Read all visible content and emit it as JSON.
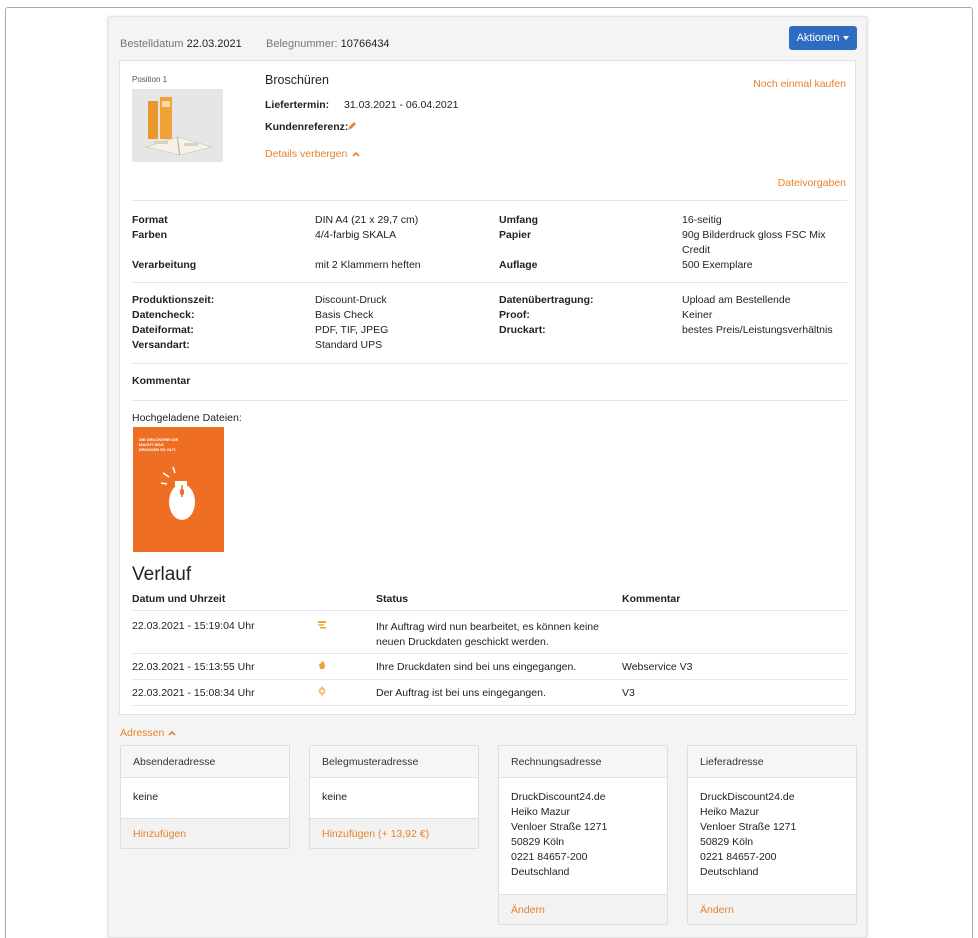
{
  "header": {
    "order_date_label": "Bestelldatum",
    "order_date": "22.03.2021",
    "receipt_label": "Belegnummer:",
    "receipt_number": "10766434",
    "actions_label": "Aktionen"
  },
  "position": {
    "label": "Position 1",
    "product": "Broschüren",
    "delivery_label": "Liefertermin:",
    "delivery_value": "31.03.2021 - 06.04.2021",
    "customer_ref_label": "Kundenreferenz:",
    "hide_details": "Details verbergen",
    "buy_again": "Noch einmal kaufen",
    "file_specs": "Dateivorgaben"
  },
  "specs1": [
    {
      "k1": "Format",
      "v1": "DIN A4 (21 x 29,7 cm)",
      "k2": "Umfang",
      "v2": "16-seitig"
    },
    {
      "k1": "Farben",
      "v1": "4/4-farbig SKALA",
      "k2": "Papier",
      "v2": "90g Bilderdruck gloss FSC Mix Credit"
    },
    {
      "k1": "Verarbeitung",
      "v1": "mit 2 Klammern heften",
      "k2": "Auflage",
      "v2": "500 Exemplare"
    }
  ],
  "specs2": [
    {
      "k1": "Produktionszeit:",
      "v1": "Discount-Druck",
      "k2": "Datenübertragung:",
      "v2": "Upload am Bestellende"
    },
    {
      "k1": "Datencheck:",
      "v1": "Basis Check",
      "k2": "Proof:",
      "v2": "Keiner"
    },
    {
      "k1": "Dateiformat:",
      "v1": "PDF, TIF, JPEG",
      "k2": "Druckart:",
      "v2": "bestes Preis/Leistungsverhältnis"
    },
    {
      "k1": "Versandart:",
      "v1": "Standard UPS",
      "k2": "",
      "v2": ""
    }
  ],
  "comment_label": "Kommentar",
  "uploaded_label": "Hochgeladene Dateien:",
  "upload_thumb_text": "DIE DRUCKEREI DIE MACHT WAS DRUCKEN SO GUT.",
  "history": {
    "title": "Verlauf",
    "col_date": "Datum und Uhrzeit",
    "col_status": "Status",
    "col_comment": "Kommentar",
    "rows": [
      {
        "date": "22.03.2021 - 15:19:04 Uhr",
        "icon": "process-icon",
        "status_line1": "Ihr Auftrag wird nun bearbeitet, es können keine",
        "status_line2": "neuen Druckdaten geschickt werden.",
        "comment": ""
      },
      {
        "date": "22.03.2021 - 15:13:55 Uhr",
        "icon": "hand-icon",
        "status_line1": "Ihre Druckdaten sind bei uns eingegangen.",
        "status_line2": "",
        "comment": "Webservice V3"
      },
      {
        "date": "22.03.2021 - 15:08:34 Uhr",
        "icon": "gear-icon",
        "status_line1": "Der Auftrag ist bei uns eingegangen.",
        "status_line2": "",
        "comment": "V3"
      }
    ]
  },
  "addresses": {
    "toggle": "Adressen",
    "cards": [
      {
        "title": "Absenderadresse",
        "lines": [
          "keine"
        ],
        "action": "Hinzufügen"
      },
      {
        "title": "Belegmusteradresse",
        "lines": [
          "keine"
        ],
        "action": "Hinzufügen (+ 13,92 €)"
      },
      {
        "title": "Rechnungsadresse",
        "lines": [
          "DruckDiscount24.de",
          "Heiko Mazur",
          "Venloer Straße 1271",
          "50829 Köln",
          "0221 84657-200",
          "Deutschland"
        ],
        "action": "Ändern"
      },
      {
        "title": "Lieferadresse",
        "lines": [
          "DruckDiscount24.de",
          "Heiko Mazur",
          "Venloer Straße 1271",
          "50829 Köln",
          "0221 84657-200",
          "Deutschland"
        ],
        "action": "Ändern"
      }
    ]
  },
  "colors": {
    "accent": "#e8822e",
    "primary_button": "#2d6cc0"
  }
}
